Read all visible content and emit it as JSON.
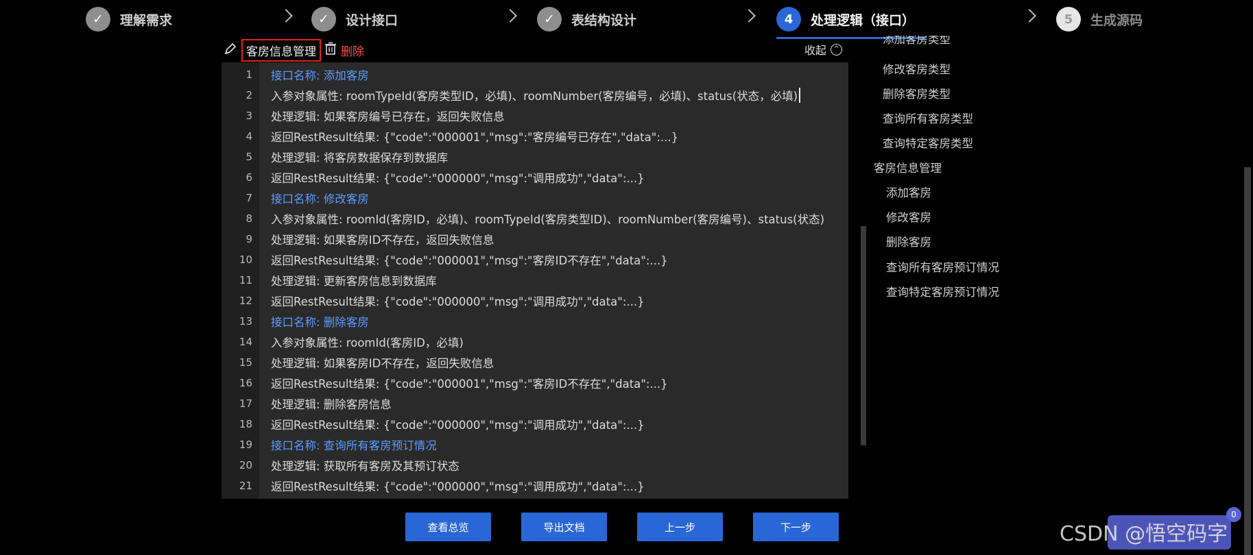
{
  "steps": [
    {
      "num": "✓",
      "label": "理解需求"
    },
    {
      "num": "✓",
      "label": "设计接口"
    },
    {
      "num": "✓",
      "label": "表结构设计"
    },
    {
      "num": "4",
      "label": "处理逻辑（接口）"
    },
    {
      "num": "5",
      "label": "生成源码"
    }
  ],
  "module": {
    "name": "客房信息管理",
    "delete_label": "删除",
    "collapse_label": "收起"
  },
  "editor": {
    "lines": [
      {
        "n": "1",
        "text": "接口名称: 添加客房",
        "kind": "api"
      },
      {
        "n": "2",
        "text": "入参对象属性: roomTypeId(客房类型ID，必填)、roomNumber(客房编号，必填)、status(状态，必填)",
        "kind": "text"
      },
      {
        "n": "3",
        "text": "处理逻辑: 如果客房编号已存在，返回失败信息",
        "kind": "text"
      },
      {
        "n": "4",
        "text": "返回RestResult结果: {\"code\":\"000001\",\"msg\":\"客房编号已存在\",\"data\":...}",
        "kind": "text"
      },
      {
        "n": "5",
        "text": "处理逻辑: 将客房数据保存到数据库",
        "kind": "text"
      },
      {
        "n": "6",
        "text": "返回RestResult结果: {\"code\":\"000000\",\"msg\":\"调用成功\",\"data\":...}",
        "kind": "text"
      },
      {
        "n": "7",
        "text": "接口名称: 修改客房",
        "kind": "api"
      },
      {
        "n": "8",
        "text": "入参对象属性: roomId(客房ID，必填)、roomTypeId(客房类型ID)、roomNumber(客房编号)、status(状态)",
        "kind": "text"
      },
      {
        "n": "9",
        "text": "处理逻辑: 如果客房ID不存在，返回失败信息",
        "kind": "text"
      },
      {
        "n": "10",
        "text": "返回RestResult结果: {\"code\":\"000001\",\"msg\":\"客房ID不存在\",\"data\":...}",
        "kind": "text"
      },
      {
        "n": "11",
        "text": "处理逻辑: 更新客房信息到数据库",
        "kind": "text"
      },
      {
        "n": "12",
        "text": "返回RestResult结果: {\"code\":\"000000\",\"msg\":\"调用成功\",\"data\":...}",
        "kind": "text"
      },
      {
        "n": "13",
        "text": "接口名称: 删除客房",
        "kind": "api"
      },
      {
        "n": "14",
        "text": "入参对象属性: roomId(客房ID，必填)",
        "kind": "text"
      },
      {
        "n": "15",
        "text": "处理逻辑: 如果客房ID不存在，返回失败信息",
        "kind": "text"
      },
      {
        "n": "16",
        "text": "返回RestResult结果: {\"code\":\"000001\",\"msg\":\"客房ID不存在\",\"data\":...}",
        "kind": "text"
      },
      {
        "n": "17",
        "text": "处理逻辑: 删除客房信息",
        "kind": "text"
      },
      {
        "n": "18",
        "text": "返回RestResult结果: {\"code\":\"000000\",\"msg\":\"调用成功\",\"data\":...}",
        "kind": "text"
      },
      {
        "n": "19",
        "text": "接口名称: 查询所有客房预订情况",
        "kind": "api"
      },
      {
        "n": "20",
        "text": "处理逻辑: 获取所有客房及其预订状态",
        "kind": "text"
      },
      {
        "n": "21",
        "text": "返回RestResult结果: {\"code\":\"000000\",\"msg\":\"调用成功\",\"data\":...}",
        "kind": "text"
      }
    ]
  },
  "tree": {
    "partial_top": "添加客房类型",
    "group1_items": [
      "修改客房类型",
      "删除客房类型",
      "查询所有客房类型",
      "查询特定客房类型"
    ],
    "group2_title": "客房信息管理",
    "group2_items": [
      "添加客房",
      "修改客房",
      "删除客房",
      "查询所有客房预订情况",
      "查询特定客房预订情况"
    ]
  },
  "buttons": {
    "overview": "查看总览",
    "export": "导出文档",
    "prev": "上一步",
    "next": "下一步"
  },
  "watermark": "CSDN @悟空码字",
  "badge": "0"
}
